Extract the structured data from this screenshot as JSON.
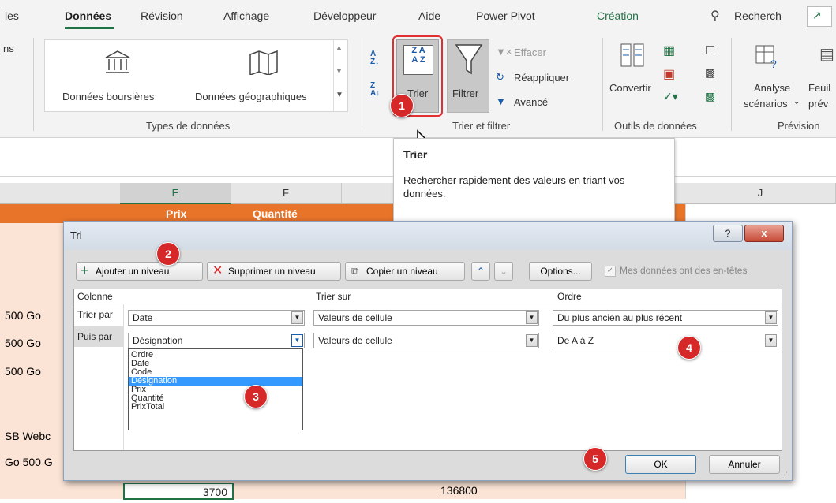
{
  "tabs": [
    "les",
    "Données",
    "Révision",
    "Affichage",
    "Développeur",
    "Aide",
    "Power Pivot",
    "Création",
    "Recherch"
  ],
  "ribbon": {
    "left_fragment": "ns",
    "data_types": {
      "stocks": "Données boursières",
      "geo": "Données géographiques",
      "group": "Types de données"
    },
    "sort_filter": {
      "sort_btn": "Trier",
      "filter_btn": "Filtrer",
      "clear": "Effacer",
      "reapply": "Réappliquer",
      "advanced": "Avancé",
      "group": "Trier et filtrer"
    },
    "data_tools": {
      "convert": "Convertir",
      "group": "Outils de données"
    },
    "forecast": {
      "scenario": "Analyse",
      "scenario2": "scénarios",
      "sheet": "Feuil",
      "sheet2": "prév",
      "group": "Prévision"
    }
  },
  "tooltip": {
    "title": "Trier",
    "body": "Rechercher rapidement des valeurs en triant vos données."
  },
  "sheet": {
    "columns": [
      "E",
      "F",
      "J"
    ],
    "header_partial": [
      "Prix",
      "Quantité"
    ],
    "left_cells": [
      "500 Go",
      "500 Go",
      "500 Go",
      "SB Webc",
      "Go 500 G"
    ],
    "bottom_values": [
      "3700",
      "136800"
    ]
  },
  "dialog": {
    "title": "Tri",
    "help": "?",
    "close": "x",
    "add_level": "Ajouter un niveau",
    "delete_level": "Supprimer un niveau",
    "copy_level": "Copier un niveau",
    "options": "Options...",
    "has_headers": "Mes données ont des en-têtes",
    "col_header": "Colonne",
    "sorton_header": "Trier sur",
    "order_header": "Ordre",
    "rows": [
      {
        "label": "Trier par",
        "column": "Date",
        "sort_on": "Valeurs de cellule",
        "order": "Du plus ancien au plus récent"
      },
      {
        "label": "Puis par",
        "column": "Désignation",
        "sort_on": "Valeurs de cellule",
        "order": "De A à Z"
      }
    ],
    "dropdown_items": [
      "Ordre",
      "Date",
      "Code",
      "Désignation",
      "Prix",
      "Quantité",
      "PrixTotal"
    ],
    "ok": "OK",
    "cancel": "Annuler"
  },
  "badges": [
    "1",
    "2",
    "3",
    "4",
    "5"
  ]
}
